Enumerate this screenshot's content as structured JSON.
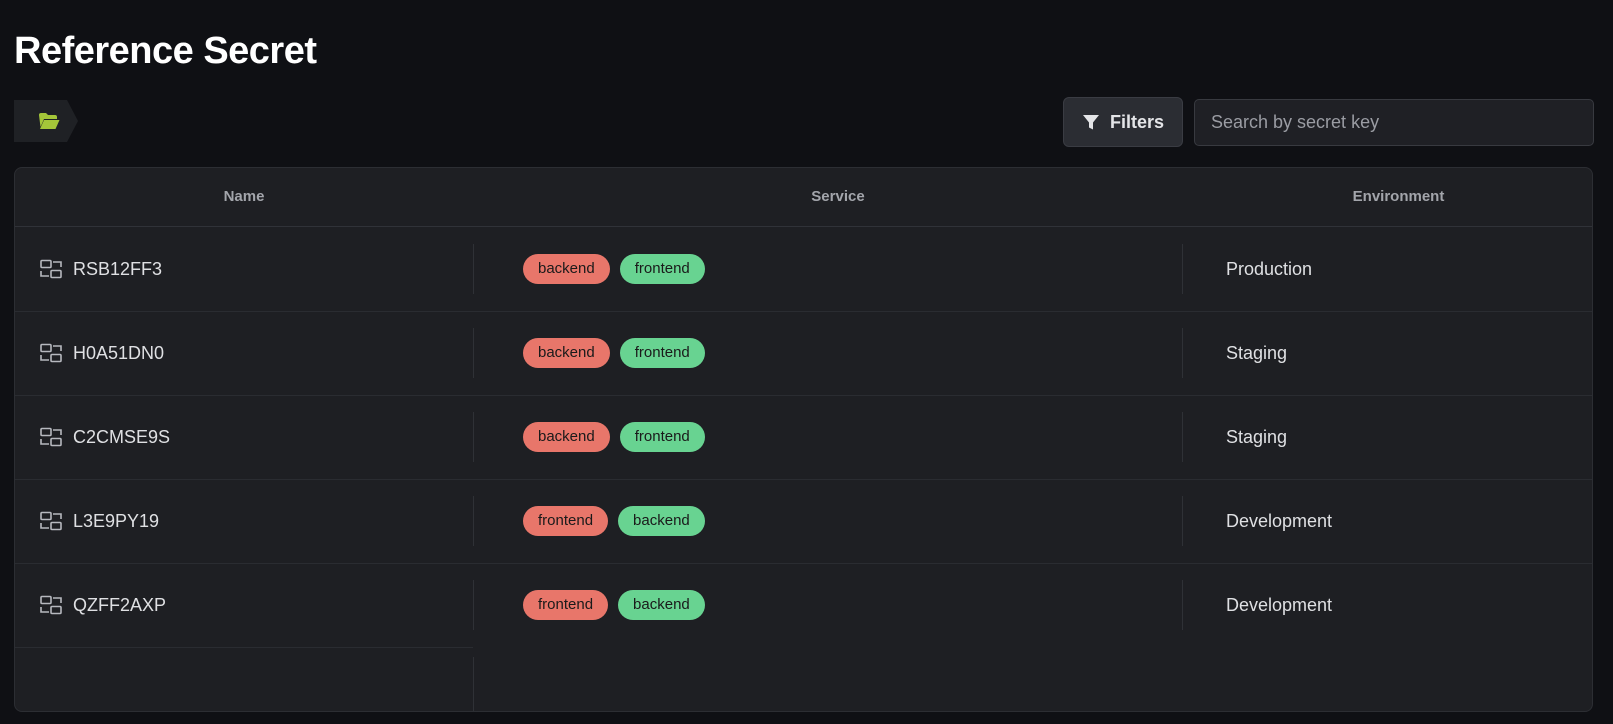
{
  "page": {
    "title": "Reference Secret"
  },
  "breadcrumb": {
    "icon": "folder-open-icon",
    "icon_color": "#a4c639"
  },
  "toolbar": {
    "filters_label": "Filters",
    "filters_icon": "funnel-icon",
    "search_placeholder": "Search by secret key",
    "search_value": ""
  },
  "table": {
    "columns": {
      "name": "Name",
      "service": "Service",
      "environment": "Environment"
    },
    "rows": [
      {
        "name": "RSB12FF3",
        "tags": [
          {
            "label": "backend",
            "color": "#e8766a"
          },
          {
            "label": "frontend",
            "color": "#68d391"
          }
        ],
        "environment": "Production"
      },
      {
        "name": "H0A51DN0",
        "tags": [
          {
            "label": "backend",
            "color": "#e8766a"
          },
          {
            "label": "frontend",
            "color": "#68d391"
          }
        ],
        "environment": "Staging"
      },
      {
        "name": "C2CMSE9S",
        "tags": [
          {
            "label": "backend",
            "color": "#e8766a"
          },
          {
            "label": "frontend",
            "color": "#68d391"
          }
        ],
        "environment": "Staging"
      },
      {
        "name": "L3E9PY19",
        "tags": [
          {
            "label": "frontend",
            "color": "#e8766a"
          },
          {
            "label": "backend",
            "color": "#68d391"
          }
        ],
        "environment": "Development"
      },
      {
        "name": "QZFF2AXP",
        "tags": [
          {
            "label": "frontend",
            "color": "#e8766a"
          },
          {
            "label": "backend",
            "color": "#68d391"
          }
        ],
        "environment": "Development"
      }
    ],
    "row_icon": "secret-reference-icon"
  },
  "colors": {
    "background": "#0f1014",
    "surface": "#1e1f23",
    "tag_red": "#e8766a",
    "tag_green": "#68d391"
  }
}
